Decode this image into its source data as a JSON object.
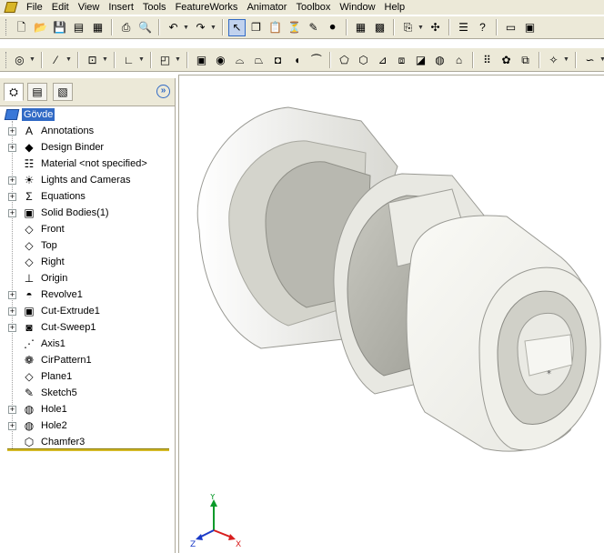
{
  "menu": [
    "File",
    "Edit",
    "View",
    "Insert",
    "Tools",
    "FeatureWorks",
    "Animator",
    "Toolbox",
    "Window",
    "Help"
  ],
  "toolbar1": [
    {
      "name": "new-icon",
      "glyph": "🗋"
    },
    {
      "name": "open-icon",
      "glyph": "📂"
    },
    {
      "name": "save-icon",
      "glyph": "💾"
    },
    {
      "name": "make-drawing-icon",
      "glyph": "▤"
    },
    {
      "name": "make-assembly-icon",
      "glyph": "▦"
    },
    {
      "name": "print-icon",
      "glyph": "⎙"
    },
    {
      "name": "print-preview-icon",
      "glyph": "🔍"
    },
    {
      "name": "undo-icon",
      "glyph": "↶"
    },
    {
      "name": "redo-icon",
      "glyph": "↷"
    },
    {
      "name": "select-icon",
      "glyph": "↖"
    },
    {
      "name": "copy-icon",
      "glyph": "❐"
    },
    {
      "name": "paste-icon",
      "glyph": "📋"
    },
    {
      "name": "filter-icon",
      "glyph": "⏳"
    },
    {
      "name": "sketch-icon",
      "glyph": "✎"
    },
    {
      "name": "traffic-light-icon",
      "glyph": "⚫"
    },
    {
      "name": "grid-icon",
      "glyph": "▦"
    },
    {
      "name": "brick-icon",
      "glyph": "▩"
    },
    {
      "name": "insert-component-icon",
      "glyph": "⎘"
    },
    {
      "name": "mate-icon",
      "glyph": "✣"
    },
    {
      "name": "options-icon",
      "glyph": "☰"
    },
    {
      "name": "help-icon",
      "glyph": "?"
    },
    {
      "name": "monitor-icon",
      "glyph": "▭"
    },
    {
      "name": "display-icon",
      "glyph": "▣"
    }
  ],
  "toolbar2": [
    {
      "name": "view-orientation-icon",
      "glyph": "◎"
    },
    {
      "name": "axis-icon",
      "glyph": "⁄"
    },
    {
      "name": "display-style-icon",
      "glyph": "⊡"
    },
    {
      "name": "angle-icon",
      "glyph": "∟"
    },
    {
      "name": "section-view-icon",
      "glyph": "◰"
    },
    {
      "name": "extruded-boss-icon",
      "glyph": "▣"
    },
    {
      "name": "revolved-boss-icon",
      "glyph": "◉"
    },
    {
      "name": "swept-boss-icon",
      "glyph": "⌓"
    },
    {
      "name": "lofted-boss-icon",
      "glyph": "⏢"
    },
    {
      "name": "extruded-cut-icon",
      "glyph": "◘"
    },
    {
      "name": "revolved-cut-icon",
      "glyph": "◖"
    },
    {
      "name": "swept-cut-icon",
      "glyph": "⏜"
    },
    {
      "name": "fillet-icon",
      "glyph": "⬠"
    },
    {
      "name": "chamfer-icon",
      "glyph": "⬡"
    },
    {
      "name": "rib-icon",
      "glyph": "⊿"
    },
    {
      "name": "shell-icon",
      "glyph": "⧈"
    },
    {
      "name": "draft-icon",
      "glyph": "◪"
    },
    {
      "name": "hole-icon",
      "glyph": "◍"
    },
    {
      "name": "dome-icon",
      "glyph": "⌂"
    },
    {
      "name": "linear-pattern-icon",
      "glyph": "⠿"
    },
    {
      "name": "circular-pattern-icon",
      "glyph": "✿"
    },
    {
      "name": "mirror-icon",
      "glyph": "⧉"
    },
    {
      "name": "reference-geometry-icon",
      "glyph": "✧"
    },
    {
      "name": "curves-icon",
      "glyph": "∽"
    }
  ],
  "feature_tabs": [
    {
      "name": "tab-featuremanager",
      "glyph": "⛭"
    },
    {
      "name": "tab-propertymanager",
      "glyph": "▤"
    },
    {
      "name": "tab-configurationmanager",
      "glyph": "▧"
    }
  ],
  "tree": {
    "root": "Gövde",
    "items": [
      {
        "label": "Annotations",
        "icon": "A",
        "name": "annotations-icon",
        "expander": "+"
      },
      {
        "label": "Design Binder",
        "icon": "◆",
        "name": "design-binder-icon",
        "expander": "+"
      },
      {
        "label": "Material <not specified>",
        "icon": "☷",
        "name": "material-icon",
        "expander": ""
      },
      {
        "label": "Lights and Cameras",
        "icon": "☀",
        "name": "lights-icon",
        "expander": "+"
      },
      {
        "label": "Equations",
        "icon": "Σ",
        "name": "equations-icon",
        "expander": "+"
      },
      {
        "label": "Solid Bodies(1)",
        "icon": "▣",
        "name": "solid-bodies-icon",
        "expander": "+"
      },
      {
        "label": "Front",
        "icon": "◇",
        "name": "plane-icon",
        "expander": ""
      },
      {
        "label": "Top",
        "icon": "◇",
        "name": "plane-icon",
        "expander": ""
      },
      {
        "label": "Right",
        "icon": "◇",
        "name": "plane-icon",
        "expander": ""
      },
      {
        "label": "Origin",
        "icon": "⊥",
        "name": "origin-icon",
        "expander": ""
      },
      {
        "label": "Revolve1",
        "icon": "◓",
        "name": "revolve-icon",
        "expander": "+"
      },
      {
        "label": "Cut-Extrude1",
        "icon": "▣",
        "name": "cut-extrude-icon",
        "expander": "+"
      },
      {
        "label": "Cut-Sweep1",
        "icon": "◙",
        "name": "cut-sweep-icon",
        "expander": "+"
      },
      {
        "label": "Axis1",
        "icon": "⋰",
        "name": "axis-icon",
        "expander": ""
      },
      {
        "label": "CirPattern1",
        "icon": "❁",
        "name": "circular-pattern-icon",
        "expander": ""
      },
      {
        "label": "Plane1",
        "icon": "◇",
        "name": "plane-icon",
        "expander": ""
      },
      {
        "label": "Sketch5",
        "icon": "✎",
        "name": "sketch-icon",
        "expander": ""
      },
      {
        "label": "Hole1",
        "icon": "◍",
        "name": "hole-icon",
        "expander": "+"
      },
      {
        "label": "Hole2",
        "icon": "◍",
        "name": "hole-icon",
        "expander": "+"
      },
      {
        "label": "Chamfer3",
        "icon": "⬡",
        "name": "chamfer-icon",
        "expander": ""
      }
    ]
  },
  "triad": {
    "y": "Y",
    "z": "Z",
    "x": "X"
  },
  "colors": {
    "accent": "#316ac5",
    "chrome": "#ece9d8",
    "rollback": "#d4b928",
    "model": "#f2f2ee"
  }
}
